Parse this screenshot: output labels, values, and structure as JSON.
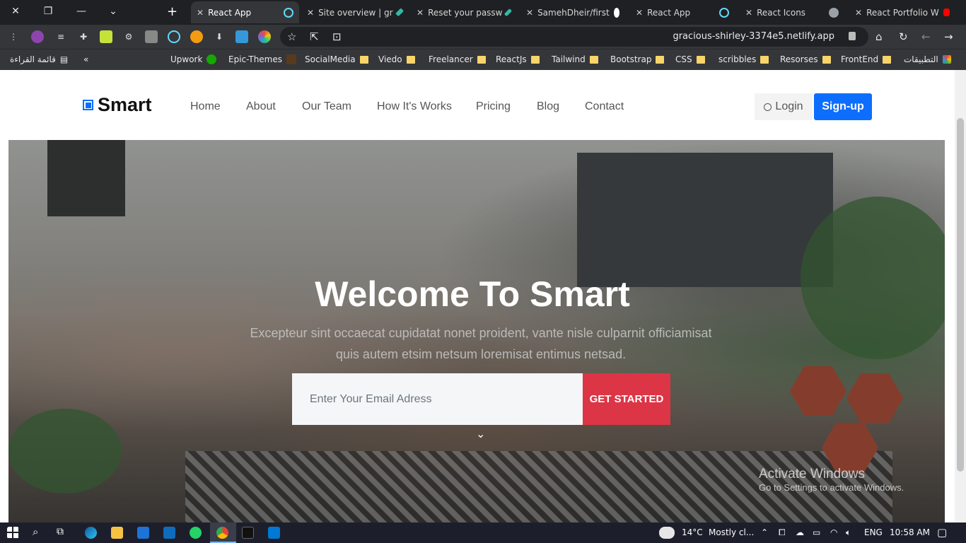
{
  "browser": {
    "tabs": [
      {
        "label": "React App",
        "active": true
      },
      {
        "label": "Site overview | gr",
        "active": false
      },
      {
        "label": "Reset your passw",
        "active": false
      },
      {
        "label": "SamehDheir/first",
        "active": false
      },
      {
        "label": "React App",
        "active": false
      },
      {
        "label": "React Icons",
        "active": false
      },
      {
        "label": "React Portfolio W",
        "active": false
      }
    ],
    "url": "gracious-shirley-3374e5.netlify.app",
    "bookmarks": {
      "reading_list": "قائمة القراءة",
      "items": [
        "Upwork",
        "Epic-Themes",
        "SocialMedia",
        "Viedo",
        "Freelancer",
        "ReactJs",
        "Tailwind",
        "Bootstrap",
        "CSS",
        "scribbles",
        "Resorses",
        "FrontEnd"
      ],
      "apps": "التطبيقات"
    }
  },
  "site": {
    "brand": "Smart",
    "nav": [
      "Home",
      "About",
      "Our Team",
      "How It's Works",
      "Pricing",
      "Blog",
      "Contact"
    ],
    "login": "Login",
    "signup": "Sign-up",
    "hero": {
      "title": "Welcome To Smart",
      "subtitle": "Excepteur sint occaecat cupidatat nonet proident, vante nisle culparnit officiamisat quis autem etsim netsum loremisat entimus netsad.",
      "email_placeholder": "Enter Your Email Adress",
      "cta": "GET STARTED"
    },
    "watermark": {
      "title": "Activate Windows",
      "subtitle": "Go to Settings to activate Windows."
    }
  },
  "taskbar": {
    "weather": "14°C",
    "weather_desc": "Mostly cl...",
    "language": "ENG",
    "time": "10:58 AM"
  },
  "colors": {
    "primary": "#0d6efd",
    "cta": "#dc3545",
    "chrome_dark": "#1f2023",
    "chrome_toolbar": "#35363a"
  }
}
